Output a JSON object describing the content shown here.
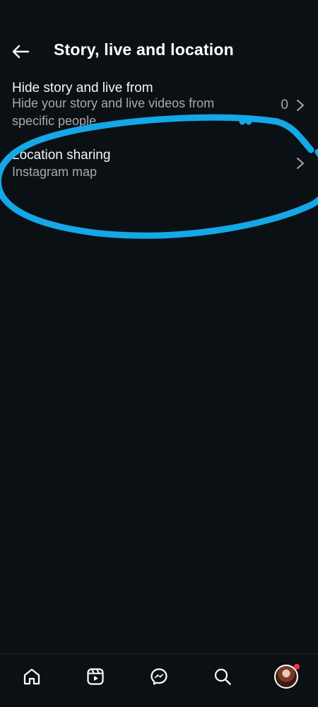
{
  "header": {
    "title": "Story, live and location",
    "back_icon": "back-arrow-icon"
  },
  "settings": [
    {
      "title": "Hide story and live from",
      "subtitle": "Hide your story and live videos from specific people.",
      "count": "0",
      "chevron_icon": "chevron-right-icon"
    },
    {
      "title": "Location sharing",
      "subtitle": "Instagram map",
      "chevron_icon": "chevron-right-icon"
    }
  ],
  "annotation": {
    "color": "#15a7e6"
  },
  "bottom_nav": {
    "items": [
      "home-icon",
      "reels-icon",
      "messenger-icon",
      "search-icon",
      "profile-avatar"
    ],
    "notification_dot_color": "#ff3040"
  },
  "colors": {
    "background": "#0b1014",
    "text_primary": "#f5f5f5",
    "text_secondary": "#a8a8a8"
  }
}
